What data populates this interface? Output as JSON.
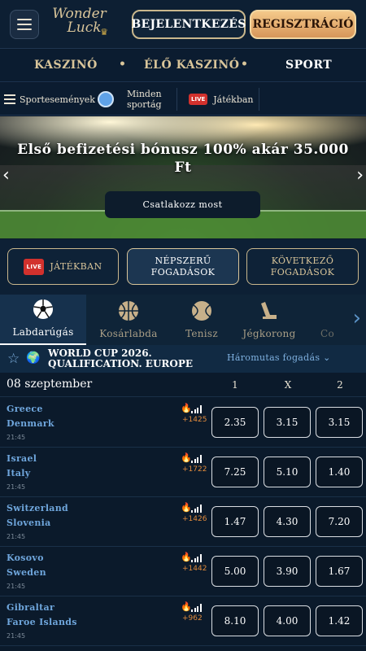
{
  "header": {
    "logo_line1": "Wonder",
    "logo_line2": "Luck",
    "login_label": "BEJELENTKEZÉS",
    "register_label": "REGISZTRÁCIÓ"
  },
  "main_nav": {
    "items": [
      {
        "label": "KASZINÓ"
      },
      {
        "label": "ÉLŐ KASZINÓ"
      },
      {
        "label": "SPORT"
      }
    ],
    "active": "SPORT"
  },
  "sub_nav": {
    "events_label": "Sportesemények",
    "all_sports_line1": "Minden",
    "all_sports_line2": "sportág",
    "live_badge": "LIVE",
    "live_label": "Játékban"
  },
  "banner": {
    "title_line1": "Első befizetési bónusz 100% akár 35.000",
    "title_line2": "Ft",
    "cta_label": "Csatlakozz most"
  },
  "filters": {
    "live_badge": "LIVE",
    "live_label": "JÁTÉKBAN",
    "popular_line1": "NÉPSZERŰ",
    "popular_line2": "FOGADÁSOK",
    "next_line1": "KÖVETKEZŐ",
    "next_line2": "FOGADÁSOK"
  },
  "sports": [
    {
      "label": "Labdarúgás",
      "icon": "soccer-ball-icon"
    },
    {
      "label": "Kosárlabda",
      "icon": "basketball-icon"
    },
    {
      "label": "Tenisz",
      "icon": "tennis-ball-icon"
    },
    {
      "label": "Jégkorong",
      "icon": "hockey-stick-icon"
    },
    {
      "label": "Co",
      "icon": "generic-sport-icon"
    }
  ],
  "league": {
    "name_line1": "WORLD CUP 2026.",
    "name_line2": "QUALIFICATION. EUROPE",
    "market": "Háromutas fogadás ⌄"
  },
  "date_row": {
    "date": "08 szeptember",
    "h1": "1",
    "hx": "X",
    "h2": "2"
  },
  "matches": [
    {
      "home": "Greece",
      "away": "Denmark",
      "time": "21:45",
      "popularity": "+1425",
      "odds": [
        "2.35",
        "3.15",
        "3.15"
      ]
    },
    {
      "home": "Israel",
      "away": "Italy",
      "time": "21:45",
      "popularity": "+1722",
      "odds": [
        "7.25",
        "5.10",
        "1.40"
      ]
    },
    {
      "home": "Switzerland",
      "away": "Slovenia",
      "time": "21:45",
      "popularity": "+1426",
      "odds": [
        "1.47",
        "4.30",
        "7.20"
      ]
    },
    {
      "home": "Kosovo",
      "away": "Sweden",
      "time": "21:45",
      "popularity": "+1442",
      "odds": [
        "5.00",
        "3.90",
        "1.67"
      ]
    },
    {
      "home": "Gibraltar",
      "away": "Faroe Islands",
      "time": "21:45",
      "popularity": "+962",
      "odds": [
        "8.10",
        "4.00",
        "1.42"
      ]
    }
  ],
  "colors": {
    "background": "#0b1a2b",
    "gold": "#d9c59a",
    "team_blue": "#6fa6dc",
    "register_orange": "#e0a468",
    "live_red": "#d2312d"
  }
}
